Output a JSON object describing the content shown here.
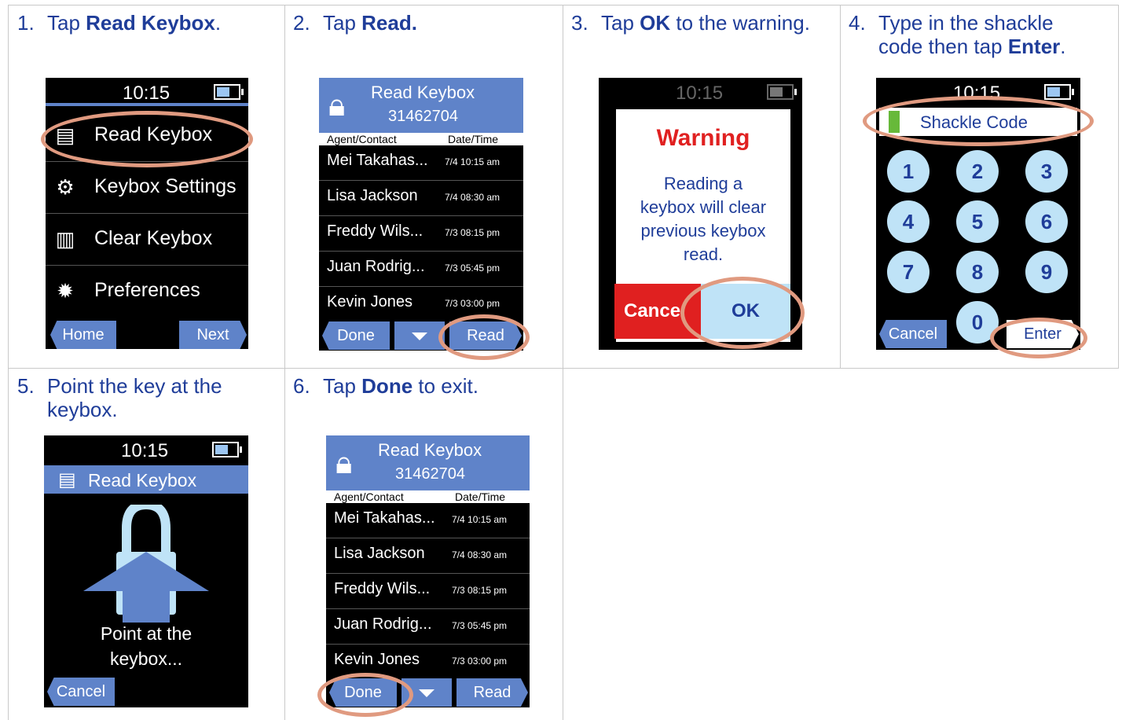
{
  "steps": [
    {
      "num": "1.",
      "pre": "Tap ",
      "bold": "Read Keybox",
      "post": "."
    },
    {
      "num": "2.",
      "pre": "Tap ",
      "bold": "Read.",
      "post": ""
    },
    {
      "num": "3.",
      "pre": "Tap ",
      "bold": "OK",
      "post": " to the warning."
    },
    {
      "num": "4.",
      "line1": "Type in the shackle",
      "pre": "code then tap ",
      "bold": "Enter",
      "post": "."
    },
    {
      "num": "5.",
      "line1": "Point the key at the",
      "line2": "keybox."
    },
    {
      "num": "6.",
      "pre": "Tap ",
      "bold": "Done",
      "post": " to exit."
    }
  ],
  "device": {
    "time": "10:15",
    "menu": [
      "Read Keybox",
      "Keybox Settings",
      "Clear Keybox",
      "Preferences"
    ],
    "home_label": "Home",
    "next_label": "Next",
    "read_title": "Read Keybox",
    "serial": "31462704",
    "col_agent": "Agent/Contact",
    "col_date": "Date/Time",
    "rows": [
      {
        "name": "Mei Takahas...",
        "date": "7/4  10:15 am"
      },
      {
        "name": "Lisa Jackson",
        "date": "7/4  08:30 am"
      },
      {
        "name": "Freddy Wils...",
        "date": "7/3  08:15 pm"
      },
      {
        "name": "Juan Rodrig...",
        "date": "7/3  05:45 pm"
      },
      {
        "name": "Kevin Jones",
        "date": "7/3  03:00 pm"
      }
    ],
    "done_label": "Done",
    "read_label": "Read",
    "warning_title": "Warning",
    "warning_lines": [
      "Reading a",
      "keybox will clear",
      "previous keybox",
      "read."
    ],
    "cancel_label": "Cancel",
    "cancel_clipped": "Cance",
    "ok_label": "OK",
    "shackle_label": "Shackle Code",
    "keys": [
      "1",
      "2",
      "3",
      "4",
      "5",
      "6",
      "7",
      "8",
      "9",
      "0"
    ],
    "enter_label": "Enter",
    "point_lines": [
      "Point at the",
      "keybox..."
    ]
  },
  "colors": {
    "text_blue": "#1f3d99",
    "header_blue": "#5f83c9",
    "callout": "#e09a80",
    "warning_red": "#e02020"
  }
}
